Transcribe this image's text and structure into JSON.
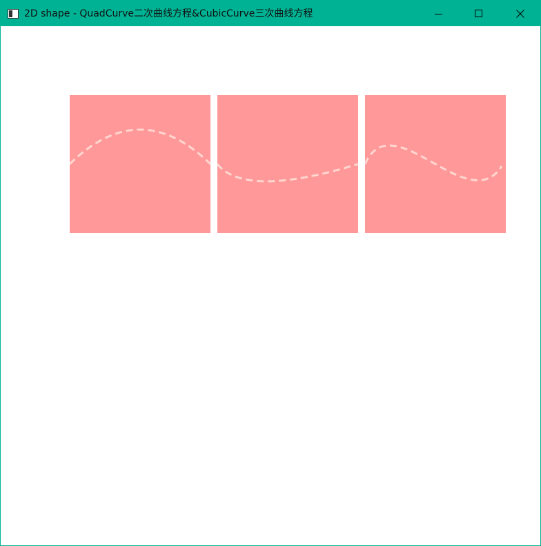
{
  "window": {
    "title": "2D shape - QuadCurve二次曲线方程&CubicCurve三次曲线方程",
    "titlebar_color": "#00b294",
    "buttons": [
      {
        "name": "minimize",
        "icon": "minimize-icon"
      },
      {
        "name": "maximize",
        "icon": "maximize-icon"
      },
      {
        "name": "close",
        "icon": "close-icon"
      }
    ]
  },
  "canvas": {
    "pane_fill": "#ff9999",
    "curve_stroke": "#ffd6d0",
    "curve_style": "dashed",
    "panes": [
      {
        "name": "pane-1",
        "shape": "quad-curve-hump"
      },
      {
        "name": "pane-2",
        "shape": "quad-curve-dip"
      },
      {
        "name": "pane-3",
        "shape": "cubic-curve-wave"
      }
    ]
  }
}
